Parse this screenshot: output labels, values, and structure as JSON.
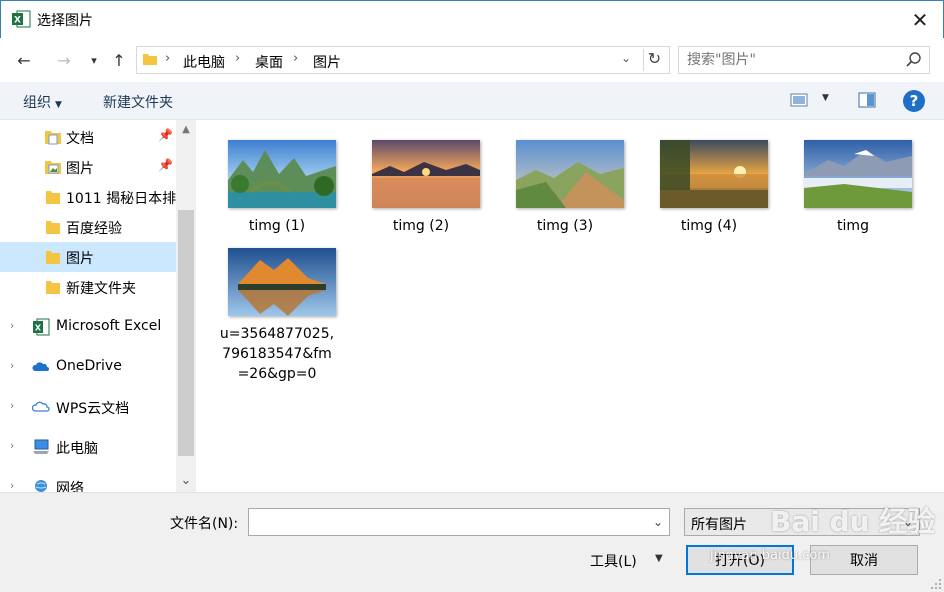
{
  "window": {
    "title": "选择图片"
  },
  "address": {
    "crumbs": [
      "此电脑",
      "桌面",
      "图片"
    ]
  },
  "search": {
    "placeholder": "搜索\"图片\""
  },
  "toolbar": {
    "organize": "组织",
    "new_folder": "新建文件夹"
  },
  "sidebar": {
    "items": [
      {
        "label": "文档",
        "icon": "documents-folder-icon",
        "pinned": true
      },
      {
        "label": "图片",
        "icon": "pictures-folder-icon",
        "pinned": true
      },
      {
        "label": "1011 揭秘日本排"
      },
      {
        "label": "百度经验"
      },
      {
        "label": "图片",
        "selected": true
      },
      {
        "label": "新建文件夹"
      },
      {
        "label": "Microsoft Excel",
        "icon": "excel-icon"
      },
      {
        "label": "OneDrive",
        "icon": "onedrive-icon"
      },
      {
        "label": "WPS云文档",
        "icon": "wps-cloud-icon"
      },
      {
        "label": "此电脑",
        "icon": "this-pc-icon"
      },
      {
        "label": "网络",
        "icon": "network-icon"
      }
    ]
  },
  "files": [
    {
      "name": "timg (1)"
    },
    {
      "name": "timg (2)"
    },
    {
      "name": "timg (3)"
    },
    {
      "name": "timg (4)"
    },
    {
      "name": "timg"
    },
    {
      "name": "u=3564877025,796183547&fm=26&gp=0",
      "lines": [
        "u=3564877025,",
        "796183547&fm",
        "=26&gp=0"
      ]
    }
  ],
  "footer": {
    "filename_label": "文件名(N):",
    "filename_value": "",
    "filetype": "所有图片",
    "tools": "工具(L)",
    "open": "打开(O)",
    "cancel": "取消"
  },
  "watermark": {
    "brand": "Bai du 经验",
    "url": "jingyan.baidu.com"
  },
  "colors": {
    "accent": "#0078d7",
    "selected": "#cce8ff",
    "toolbar_bg": "#f0f4f9",
    "folder": "#f4c542"
  }
}
